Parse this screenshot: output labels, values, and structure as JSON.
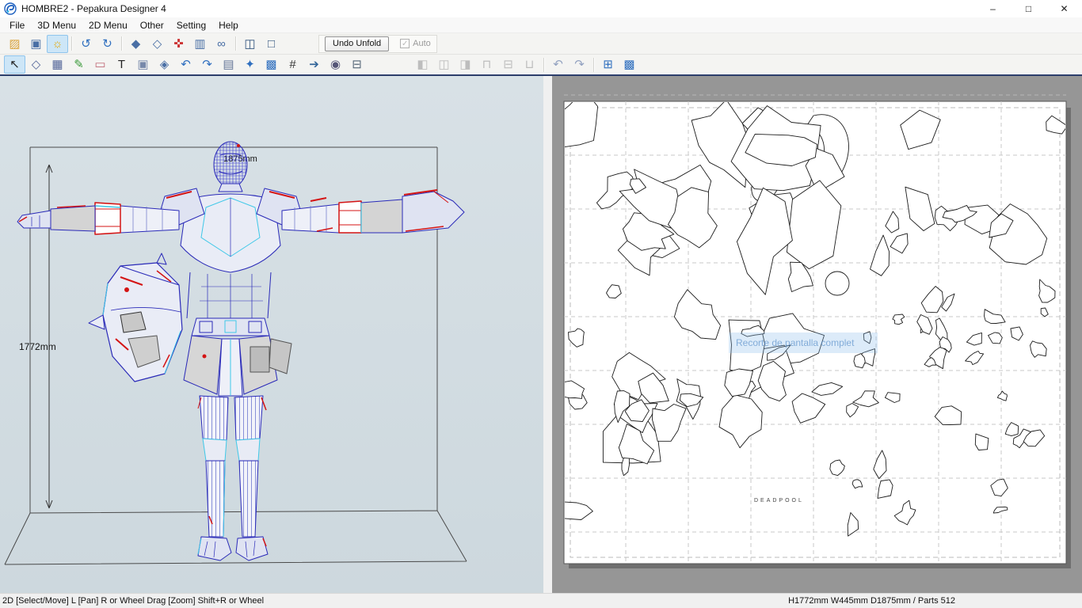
{
  "window": {
    "title": "HOMBRE2 - Pepakura Designer 4",
    "minimize_glyph": "–",
    "maximize_glyph": "□",
    "close_glyph": "✕"
  },
  "menu": {
    "items": [
      "File",
      "3D Menu",
      "2D Menu",
      "Other",
      "Setting",
      "Help"
    ]
  },
  "toolbar_top": {
    "undo_unfold_label": "Undo Unfold",
    "auto_label": "Auto",
    "auto_check_glyph": "✓",
    "buttons": [
      {
        "name": "open-file-icon",
        "glyph": "▨",
        "color": "#d9a33c"
      },
      {
        "name": "save-file-icon",
        "glyph": "▣",
        "color": "#4a6fa5"
      },
      {
        "name": "render-toggle-icon",
        "glyph": "☼",
        "color": "#e8a800",
        "state": "active"
      },
      {
        "name": "separator"
      },
      {
        "name": "rotate-view-icon",
        "glyph": "↺",
        "color": "#2f6fbf"
      },
      {
        "name": "spin-view-icon",
        "glyph": "↻",
        "color": "#2f6fbf"
      },
      {
        "name": "separator"
      },
      {
        "name": "show-solid-icon",
        "glyph": "◆",
        "color": "#4a6fa5"
      },
      {
        "name": "show-wire-icon",
        "glyph": "◇",
        "color": "#4a6fa5"
      },
      {
        "name": "pin-icon",
        "glyph": "✜",
        "color": "#cc3333"
      },
      {
        "name": "measure-icon",
        "glyph": "▥",
        "color": "#4a6fa5"
      },
      {
        "name": "link-views-icon",
        "glyph": "∞",
        "color": "#4a6fa5"
      },
      {
        "name": "separator"
      },
      {
        "name": "split-view-icon",
        "glyph": "◫",
        "color": "#33557f"
      },
      {
        "name": "single-view-icon",
        "glyph": "□",
        "color": "#33557f"
      }
    ]
  },
  "toolbar_edit": {
    "buttons": [
      {
        "name": "select-move-icon",
        "glyph": "↖",
        "color": "#222222",
        "state": "active"
      },
      {
        "name": "edit-flap-icon",
        "glyph": "◇",
        "color": "#55679a"
      },
      {
        "name": "divide-face-icon",
        "glyph": "▦",
        "color": "#55679a"
      },
      {
        "name": "edge-color-icon",
        "glyph": "✎",
        "color": "#3a9a3a"
      },
      {
        "name": "eraser-icon",
        "glyph": "▭",
        "color": "#c06a77"
      },
      {
        "name": "text-tool-icon",
        "glyph": "T",
        "color": "#222222"
      },
      {
        "name": "image-tool-icon",
        "glyph": "▣",
        "color": "#7788aa"
      },
      {
        "name": "material-icon",
        "glyph": "◈",
        "color": "#4a6fa5"
      },
      {
        "name": "undo-icon",
        "glyph": "↶",
        "color": "#2f6fbf"
      },
      {
        "name": "redo-icon",
        "glyph": "↷",
        "color": "#2f6fbf"
      },
      {
        "name": "check-sheet-icon",
        "glyph": "▤",
        "color": "#667799"
      },
      {
        "name": "scatter-parts-icon",
        "glyph": "✦",
        "color": "#2f6fbf"
      },
      {
        "name": "auto-layout-icon",
        "glyph": "▩",
        "color": "#2f6fbf"
      },
      {
        "name": "numbering-icon",
        "glyph": "#",
        "color": "#333333"
      },
      {
        "name": "export-page-icon",
        "glyph": "➔",
        "color": "#336699"
      },
      {
        "name": "capture-icon",
        "glyph": "◉",
        "color": "#555577"
      },
      {
        "name": "print-icon",
        "glyph": "⊟",
        "color": "#556677"
      },
      {
        "name": "gap",
        "w": 56
      },
      {
        "name": "align-left-icon",
        "glyph": "◧",
        "color": "#b8b8b8",
        "state": "disabled"
      },
      {
        "name": "align-center-icon",
        "glyph": "◫",
        "color": "#b8b8b8",
        "state": "disabled"
      },
      {
        "name": "align-right-icon",
        "glyph": "◨",
        "color": "#b8b8b8",
        "state": "disabled"
      },
      {
        "name": "align-top-icon",
        "glyph": "⊓",
        "color": "#b8b8b8",
        "state": "disabled"
      },
      {
        "name": "align-middle-icon",
        "glyph": "⊟",
        "color": "#b8b8b8",
        "state": "disabled"
      },
      {
        "name": "align-bottom-icon",
        "glyph": "⊔",
        "color": "#b8b8b8",
        "state": "disabled"
      },
      {
        "name": "separator"
      },
      {
        "name": "rotate-ccw-icon",
        "glyph": "↶",
        "color": "#8899bb",
        "state": "disabled"
      },
      {
        "name": "rotate-cw-icon",
        "glyph": "↷",
        "color": "#8899bb",
        "state": "disabled"
      },
      {
        "name": "separator"
      },
      {
        "name": "arrange-parts-icon",
        "glyph": "⊞",
        "color": "#2f6fbf"
      },
      {
        "name": "pack-parts-icon",
        "glyph": "▩",
        "color": "#2f6fbf"
      }
    ]
  },
  "viewport_3d": {
    "height_dimension": "1772mm",
    "depth_dimension": "1875mm"
  },
  "viewport_2d": {
    "watermark": "Recorte de pantalla complet",
    "page_label": "DEADPOOL"
  },
  "status_bar": {
    "left": "2D [Select/Move] L [Pan] R or Wheel Drag [Zoom] Shift+R or Wheel",
    "right": "H1772mm W445mm D1875mm / Parts 512"
  },
  "colors": {
    "wire_blue": "#2a2ab8",
    "wire_red": "#d41414",
    "wire_cyan": "#3fc8e8",
    "pane_gray": "#969696",
    "active_button_bg": "#cde6f7"
  }
}
